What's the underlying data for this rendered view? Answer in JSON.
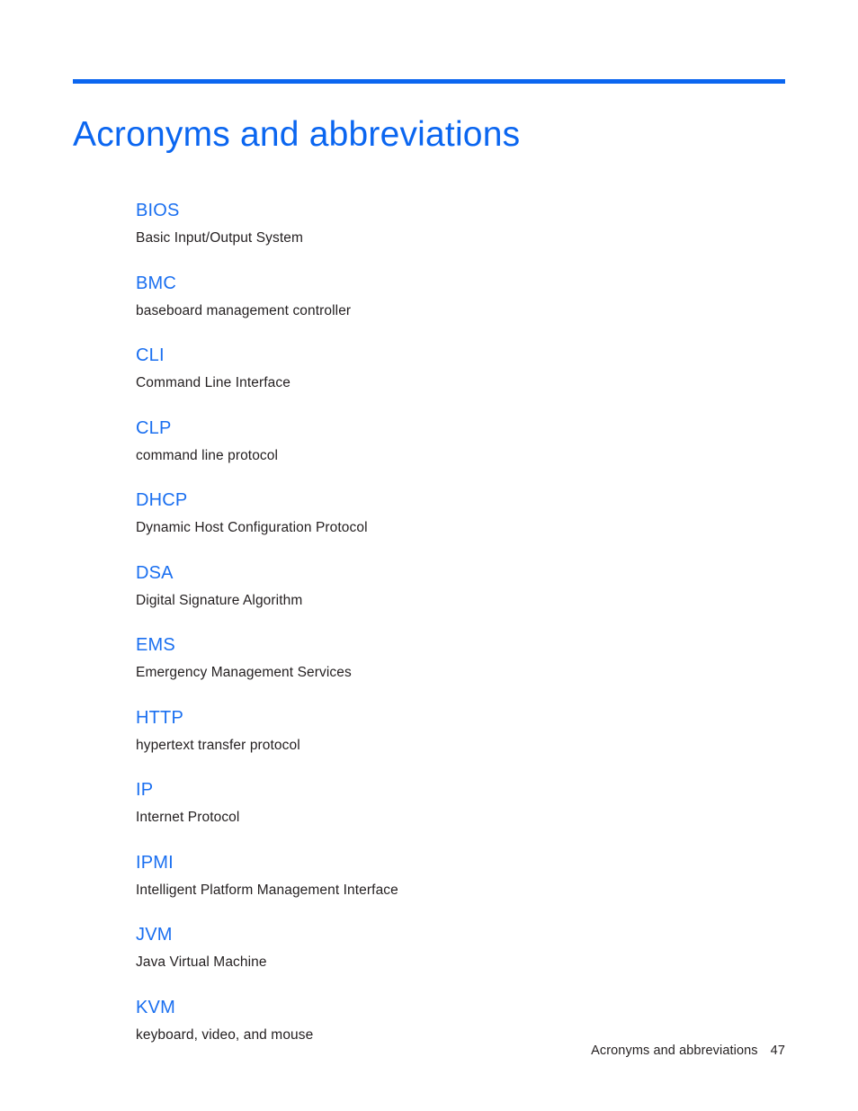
{
  "document": {
    "title": "Acronyms and abbreviations",
    "accent_color": "#0b66f0",
    "term_color": "#1a6ff0",
    "body_color": "#231f20"
  },
  "glossary": {
    "entries": [
      {
        "term": "BIOS",
        "definition": "Basic Input/Output System"
      },
      {
        "term": "BMC",
        "definition": "baseboard management controller"
      },
      {
        "term": "CLI",
        "definition": "Command Line Interface"
      },
      {
        "term": "CLP",
        "definition": "command line protocol"
      },
      {
        "term": "DHCP",
        "definition": "Dynamic Host Configuration Protocol"
      },
      {
        "term": "DSA",
        "definition": "Digital Signature Algorithm"
      },
      {
        "term": "EMS",
        "definition": "Emergency Management Services"
      },
      {
        "term": "HTTP",
        "definition": "hypertext transfer protocol"
      },
      {
        "term": "IP",
        "definition": "Internet Protocol"
      },
      {
        "term": "IPMI",
        "definition": "Intelligent Platform Management Interface"
      },
      {
        "term": "JVM",
        "definition": "Java Virtual Machine"
      },
      {
        "term": "KVM",
        "definition": "keyboard, video, and mouse"
      }
    ]
  },
  "footer": {
    "label": "Acronyms and abbreviations",
    "page_number": "47"
  }
}
